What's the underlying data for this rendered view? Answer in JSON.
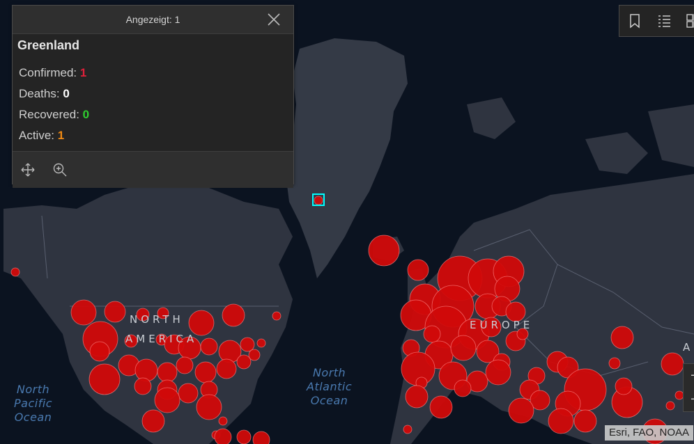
{
  "popup": {
    "count_label": "Angezeigt: 1",
    "title": "Greenland",
    "stats": [
      {
        "label": "Confirmed:",
        "value": "1",
        "color": "#e0203a"
      },
      {
        "label": "Deaths:",
        "value": "0",
        "color": "#ffffff"
      },
      {
        "label": "Recovered:",
        "value": "0",
        "color": "#2fcf2f"
      },
      {
        "label": "Active:",
        "value": "1",
        "color": "#f08a14"
      }
    ],
    "actions": [
      "pan-icon",
      "zoom-to-icon"
    ]
  },
  "toolbar": {
    "icons": [
      "bookmark-icon",
      "legend-list-icon",
      "basemap-gallery-icon"
    ]
  },
  "map": {
    "ocean_labels": [
      "North\nPacific\nOcean",
      "North\nAtlantic\nOcean"
    ],
    "region_labels": [
      "NORTH",
      "AMERICA",
      "EUROPE",
      "A"
    ],
    "bubble_color": "#d10a0a",
    "land_color": "#2f3440",
    "ocean_color": "#0b1320",
    "highlight_color": "#00ffff"
  },
  "zoom": {
    "in": "+",
    "out": "−"
  },
  "attribution": "Esri, FAO, NOAA"
}
